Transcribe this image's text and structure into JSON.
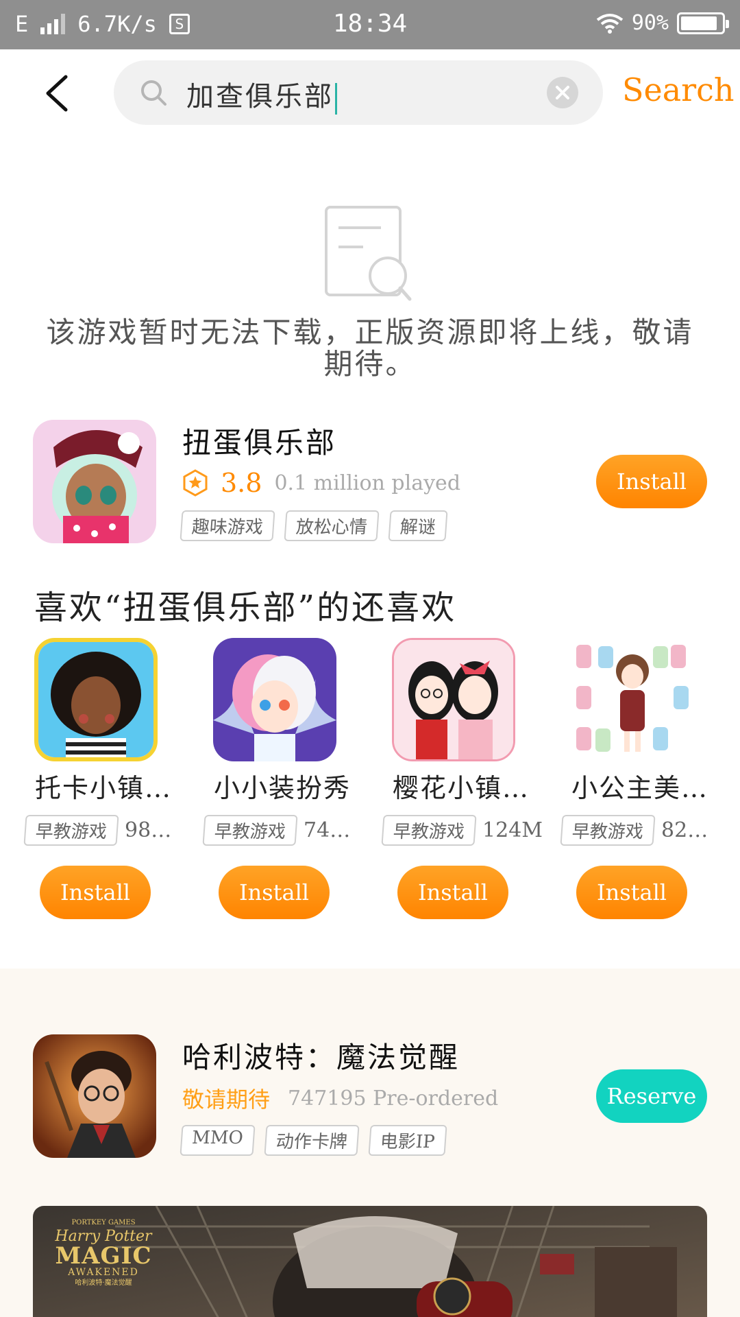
{
  "status_bar": {
    "network": "E",
    "speed": "6.7K/s",
    "s_icon": "S",
    "time": "18:34",
    "battery": "90%"
  },
  "search": {
    "query": "加查俱乐部",
    "button": "Search"
  },
  "empty_state": {
    "icon": "document-search-icon",
    "message": "该游戏暂时无法下载，正版资源即将上线，敬请期待。"
  },
  "featured_app": {
    "title": "扭蛋俱乐部",
    "rating": "3.8",
    "played": "0.1 million played",
    "tags": [
      "趣味游戏",
      "放松心情",
      "解谜"
    ],
    "button": "Install"
  },
  "recommend": {
    "title": "喜欢“扭蛋俱乐部”的还喜欢",
    "items": [
      {
        "name": "托卡小镇…",
        "tag": "早教游戏",
        "size": "98…",
        "button": "Install"
      },
      {
        "name": "小小装扮秀",
        "tag": "早教游戏",
        "size": "74…",
        "button": "Install"
      },
      {
        "name": "樱花小镇…",
        "tag": "早教游戏",
        "size": "124M",
        "button": "Install"
      },
      {
        "name": "小公主美…",
        "tag": "早教游戏",
        "size": "82…",
        "button": "Install"
      }
    ]
  },
  "preorder_app": {
    "title": "哈利波特：魔法觉醒",
    "status": "敬请期待",
    "count": "747195 Pre-ordered",
    "tags": [
      "MMO",
      "动作卡牌",
      "电影IP"
    ],
    "button": "Reserve",
    "banner_logo": [
      "PORTKEY GAMES",
      "Harry Potter",
      "MAGIC",
      "AWAKENED",
      "哈利波特·魔法觉醒"
    ]
  },
  "colors": {
    "accent": "#ff8a00",
    "reserve": "#12d3c0",
    "statusbar": "#8f8f8f"
  }
}
